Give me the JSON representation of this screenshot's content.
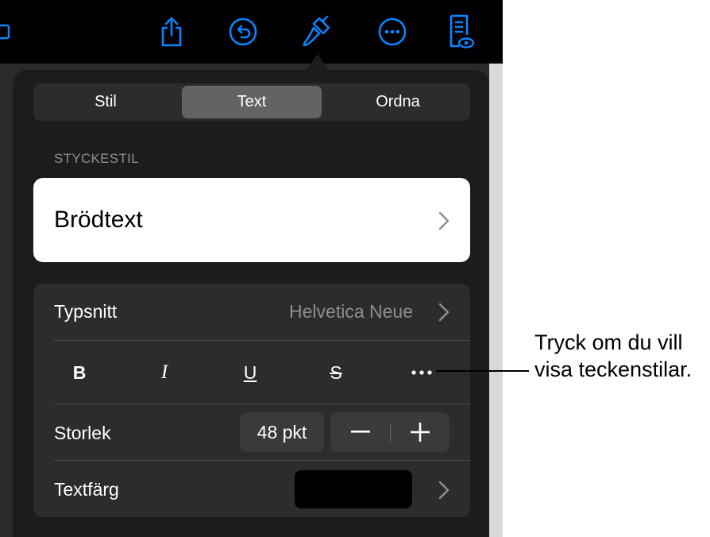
{
  "tabs": [
    {
      "label": "Stil",
      "active": false
    },
    {
      "label": "Text",
      "active": true
    },
    {
      "label": "Ordna",
      "active": false
    }
  ],
  "toolbar": {
    "icons": [
      "media-icon",
      "share-icon",
      "undo-icon",
      "format-brush-icon",
      "more-icon",
      "reader-view-icon"
    ],
    "accent_color": "#0a84ff"
  },
  "paragraph_style": {
    "header": "STYCKESTIL",
    "value": "Brödtext"
  },
  "font": {
    "label": "Typsnitt",
    "value": "Helvetica Neue"
  },
  "format_buttons": [
    "B",
    "I",
    "U",
    "S"
  ],
  "size": {
    "label": "Storlek",
    "value": "48 pkt"
  },
  "text_color": {
    "label": "Textfärg",
    "swatch": "#000000"
  },
  "callout": {
    "line1": "Tryck om du vill",
    "line2": "visa teckenstilar."
  }
}
